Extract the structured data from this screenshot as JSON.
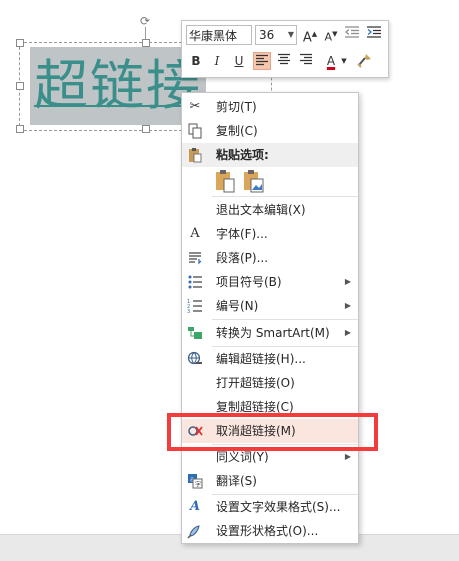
{
  "textbox": {
    "text": "超链接"
  },
  "minibar": {
    "font_name": "华康黑体",
    "font_size": "36",
    "grow_font": "A",
    "shrink_font": "A",
    "bold": "B",
    "italic": "I",
    "underline": "U",
    "font_color": "A"
  },
  "menu": {
    "cut": "剪切(T)",
    "copy": "复制(C)",
    "paste_options": "粘贴选项:",
    "exit_edit": "退出文本编辑(X)",
    "font": "字体(F)...",
    "paragraph": "段落(P)...",
    "bullets": "项目符号(B)",
    "numbering": "编号(N)",
    "smartart": "转换为 SmartArt(M)",
    "edit_link": "编辑超链接(H)...",
    "open_link": "打开超链接(O)",
    "copy_link": "复制超链接(C)",
    "remove_link": "取消超链接(M)",
    "synonyms": "同义词(Y)",
    "translate": "翻译(S)",
    "text_effects": "设置文字效果格式(S)...",
    "shape_format": "设置形状格式(O)..."
  },
  "colors": {
    "accent": "#3a8f8a",
    "highlight_box": "#f43c3c",
    "font_color_bar": "#d0021b"
  }
}
